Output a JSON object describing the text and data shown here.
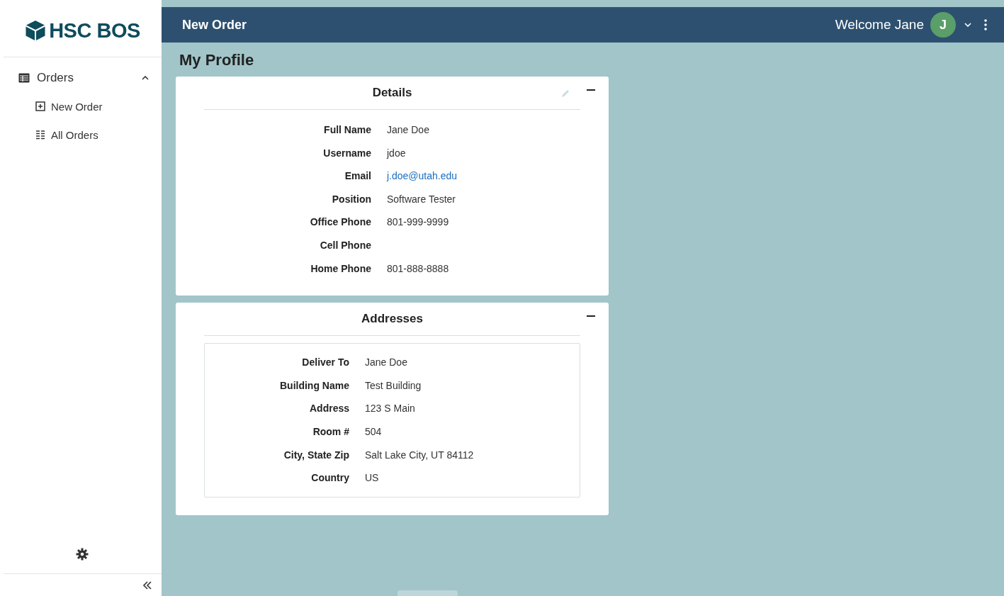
{
  "sidebar": {
    "logo": "HSC BOS",
    "groups": [
      {
        "label": "Orders",
        "expanded": true,
        "children": [
          {
            "label": "New Order",
            "kind": "add"
          },
          {
            "label": "All Orders",
            "kind": "list"
          }
        ]
      }
    ]
  },
  "header": {
    "title": "New Order",
    "welcome": "Welcome Jane",
    "avatar": "J"
  },
  "page_title": "My Profile",
  "details": {
    "title": "Details",
    "fields": [
      {
        "label": "Full Name",
        "value": "Jane Doe"
      },
      {
        "label": "Username",
        "value": "jdoe"
      },
      {
        "label": "Email",
        "value": "j.doe@utah.edu",
        "kind": "link"
      },
      {
        "label": "Position",
        "value": "Software Tester"
      },
      {
        "label": "Office Phone",
        "value": "801-999-9999"
      },
      {
        "label": "Cell Phone"
      },
      {
        "label": "Home Phone",
        "value": "801-888-8888"
      }
    ]
  },
  "addresses": {
    "title": "Addresses",
    "fields": [
      {
        "label": "Deliver To",
        "value": "Jane Doe"
      },
      {
        "label": "Building Name",
        "value": "Test Building"
      },
      {
        "label": "Address",
        "value": "123 S Main"
      },
      {
        "label": "Room #",
        "value": "504"
      },
      {
        "label": "City, State Zip",
        "value": "Salt Lake City, UT 84112"
      },
      {
        "label": "Country",
        "value": "US"
      }
    ]
  }
}
